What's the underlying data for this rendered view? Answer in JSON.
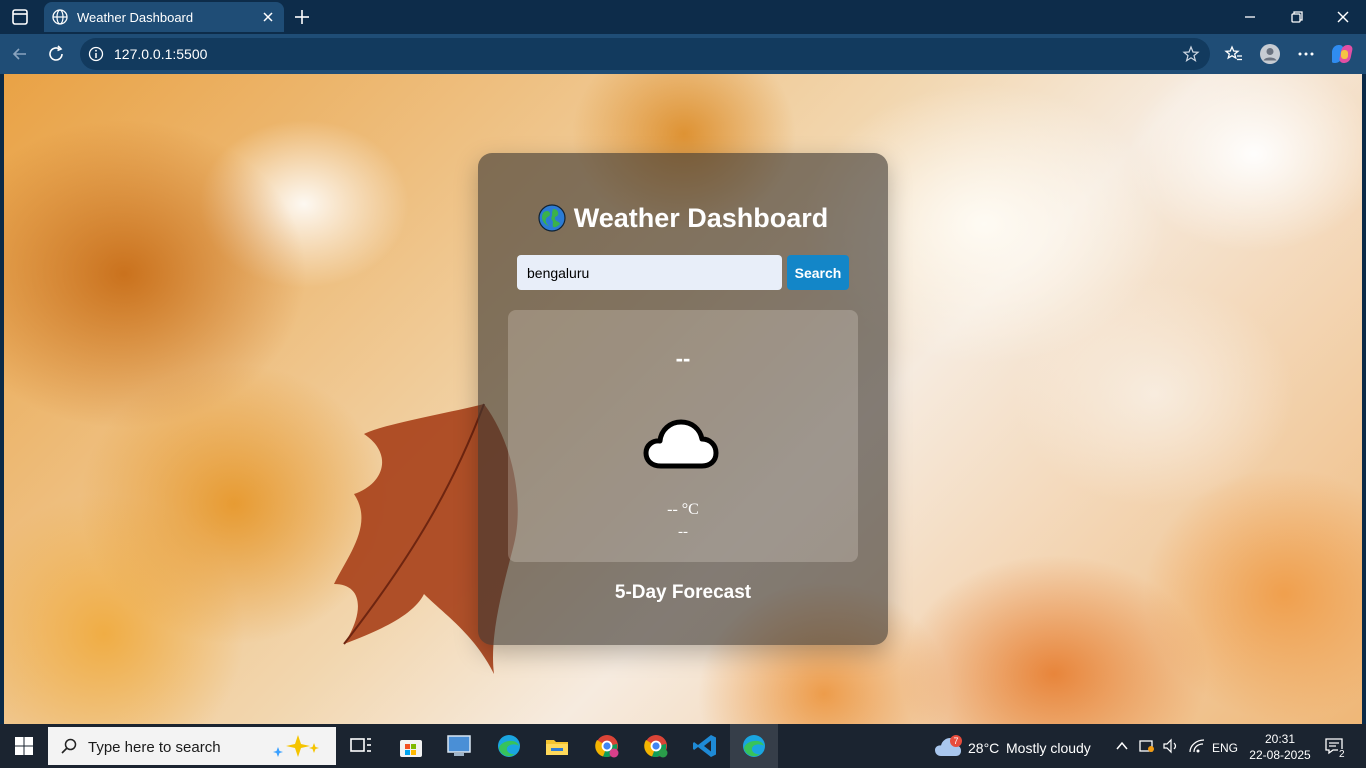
{
  "browser": {
    "tab_title": "Weather Dashboard",
    "url": "127.0.0.1:5500"
  },
  "app": {
    "title": "Weather Dashboard",
    "title_icon": "globe-icon",
    "search": {
      "value": "bengaluru",
      "placeholder": "",
      "button_label": "Search"
    },
    "current": {
      "city": "--",
      "icon": "cloud-icon",
      "temperature": "-- °C",
      "description": "--"
    },
    "forecast_title": "5-Day Forecast"
  },
  "taskbar": {
    "search_placeholder": "Type here to search",
    "weather_temp": "28°C",
    "weather_desc": "Mostly cloudy",
    "weather_badge": "7",
    "language": "ENG",
    "time": "20:31",
    "date": "22-08-2025",
    "notifications": "2"
  },
  "colors": {
    "search_button": "#1386c8",
    "card_bg": "rgba(60,55,50,0.62)",
    "chrome": "#1f4d76"
  }
}
